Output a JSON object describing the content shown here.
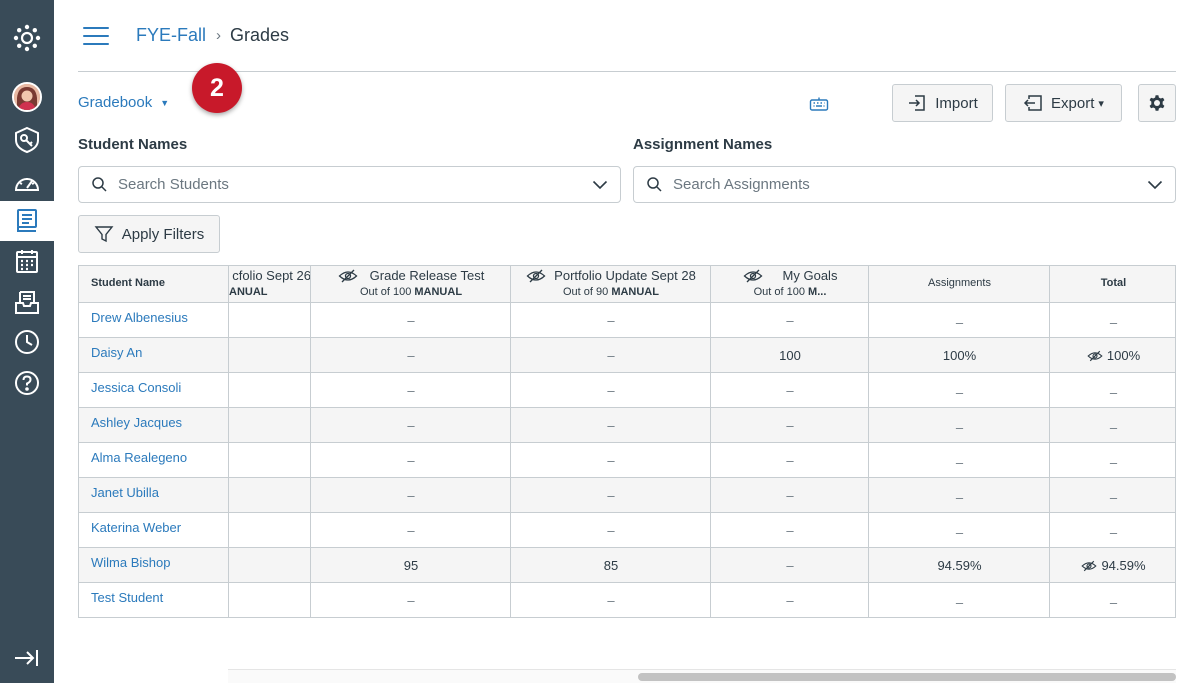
{
  "global_nav": {
    "items": [
      {
        "icon": "canvas-logo-icon"
      },
      {
        "icon": "account-avatar-icon"
      },
      {
        "icon": "admin-shield-icon"
      },
      {
        "icon": "dashboard-gauge-icon"
      },
      {
        "icon": "courses-book-icon",
        "active": true
      },
      {
        "icon": "calendar-icon"
      },
      {
        "icon": "inbox-icon"
      },
      {
        "icon": "history-clock-icon"
      },
      {
        "icon": "help-question-icon"
      }
    ],
    "collapse_icon": "collapse-nav-icon"
  },
  "breadcrumb": {
    "course": "FYE-Fall",
    "separator": "›",
    "current": "Grades"
  },
  "toolbar": {
    "gradebook_label": "Gradebook",
    "step_badge": "2",
    "import_label": "Import",
    "export_label": "Export",
    "export_caret": "▾",
    "gradebook_caret": "▼"
  },
  "filters": {
    "student_label": "Student Names",
    "student_placeholder": "Search Students",
    "assignment_label": "Assignment Names",
    "assignment_placeholder": "Search Assignments",
    "apply_filters_label": "Apply Filters"
  },
  "grid": {
    "student_header": "Student Name",
    "columns": [
      {
        "title": "cfolio Sept 26",
        "sub_prefix": "",
        "sub_bold": "ANUAL",
        "hidden_icon": false
      },
      {
        "title": "Grade Release Test",
        "sub_prefix": "Out of 100 ",
        "sub_bold": "MANUAL",
        "hidden_icon": true
      },
      {
        "title": "Portfolio Update Sept 28",
        "sub_prefix": "Out of 90 ",
        "sub_bold": "MANUAL",
        "hidden_icon": true
      },
      {
        "title": "My Goals",
        "sub_prefix": "Out of 100 ",
        "sub_bold": "M...",
        "hidden_icon": true
      }
    ],
    "assignments_header": "Assignments",
    "total_header": "Total",
    "rows": [
      {
        "name": "Drew Albenesius",
        "c2": "–",
        "c3": "–",
        "c4": "–",
        "assignments": "–",
        "total": "–",
        "total_hidden": false
      },
      {
        "name": "Daisy An",
        "c2": "–",
        "c3": "–",
        "c4": "100",
        "assignments": "100%",
        "total": "100%",
        "total_hidden": true
      },
      {
        "name": "Jessica Consoli",
        "c2": "–",
        "c3": "–",
        "c4": "–",
        "assignments": "–",
        "total": "–",
        "total_hidden": false
      },
      {
        "name": "Ashley Jacques",
        "c2": "–",
        "c3": "–",
        "c4": "–",
        "assignments": "–",
        "total": "–",
        "total_hidden": false
      },
      {
        "name": "Alma Realegeno",
        "c2": "–",
        "c3": "–",
        "c4": "–",
        "assignments": "–",
        "total": "–",
        "total_hidden": false
      },
      {
        "name": "Janet Ubilla",
        "c2": "–",
        "c3": "–",
        "c4": "–",
        "assignments": "–",
        "total": "–",
        "total_hidden": false
      },
      {
        "name": "Katerina Weber",
        "c2": "–",
        "c3": "–",
        "c4": "–",
        "assignments": "–",
        "total": "–",
        "total_hidden": false
      },
      {
        "name": "Wilma Bishop",
        "c2": "95",
        "c3": "85",
        "c4": "–",
        "assignments": "94.59%",
        "total": "94.59%",
        "total_hidden": true
      },
      {
        "name": "Test Student",
        "c2": "–",
        "c3": "–",
        "c4": "–",
        "assignments": "–",
        "total": "–",
        "total_hidden": false
      }
    ]
  },
  "colors": {
    "nav_bg": "#394b58",
    "link": "#2b7abc",
    "badge": "#c8192a",
    "border": "#c7cdd1"
  }
}
